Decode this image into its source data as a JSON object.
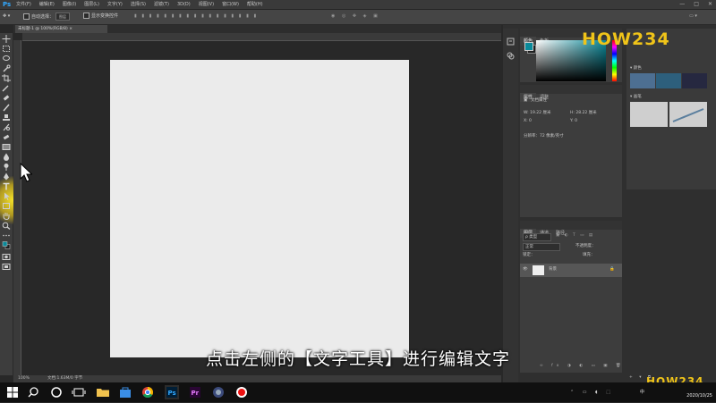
{
  "app": {
    "logo": "Ps",
    "menus": [
      "文件(F)",
      "编辑(E)",
      "图像(I)",
      "图层(L)",
      "文字(Y)",
      "选择(S)",
      "滤镜(T)",
      "3D(D)",
      "视图(V)",
      "窗口(W)",
      "帮助(H)"
    ],
    "window_controls": [
      "—",
      "□",
      "✕"
    ]
  },
  "options_bar": {
    "auto_select_label": "自动选择：",
    "auto_select_value": "图层",
    "show_transform_label": "显示变换控件"
  },
  "document": {
    "tab_title": "未标题-1 @ 100%(RGB/8) ×",
    "zoom": "100%",
    "status": "文档:1.63M/0 字节",
    "canvas_color": "#ebebeb"
  },
  "panels": {
    "color": {
      "tabs": [
        "颜色",
        "色板"
      ],
      "hue_color": "#0b8a9a"
    },
    "swatches": {
      "label": "▾ 颜色",
      "colors": [
        "#4d6f92",
        "#2d5f7c",
        "#262840"
      ]
    },
    "libraries": {
      "label": "▾ 画笔"
    },
    "properties": {
      "tabs": [
        "属性",
        "调整"
      ],
      "doc_title": "文档属性",
      "width_label": "W:",
      "width_value": "19.22 厘米",
      "height_label": "H:",
      "height_value": "28.22 厘米",
      "x_label": "X:",
      "x_value": "0",
      "y_label": "Y:",
      "y_value": "0",
      "resolution": "分辨率：72 像素/英寸"
    },
    "layers": {
      "tabs": [
        "图层",
        "通道",
        "路径"
      ],
      "kind_label": "ρ 类型",
      "blend_mode": "正常",
      "opacity_label": "不透明度：",
      "lock_label": "锁定：",
      "fill_label": "填充：",
      "layer_name": "背景"
    }
  },
  "caption": "点击左侧的【文字工具】进行编辑文字",
  "watermark": "HOW234",
  "taskbar": {
    "apps": [
      "Windows",
      "Search",
      "Cortana",
      "TaskView",
      "Explorer",
      "Store",
      "Chrome",
      "Photoshop",
      "Premiere",
      "Media",
      "Recorder"
    ],
    "date": "2020/10/25",
    "ime": "中"
  }
}
